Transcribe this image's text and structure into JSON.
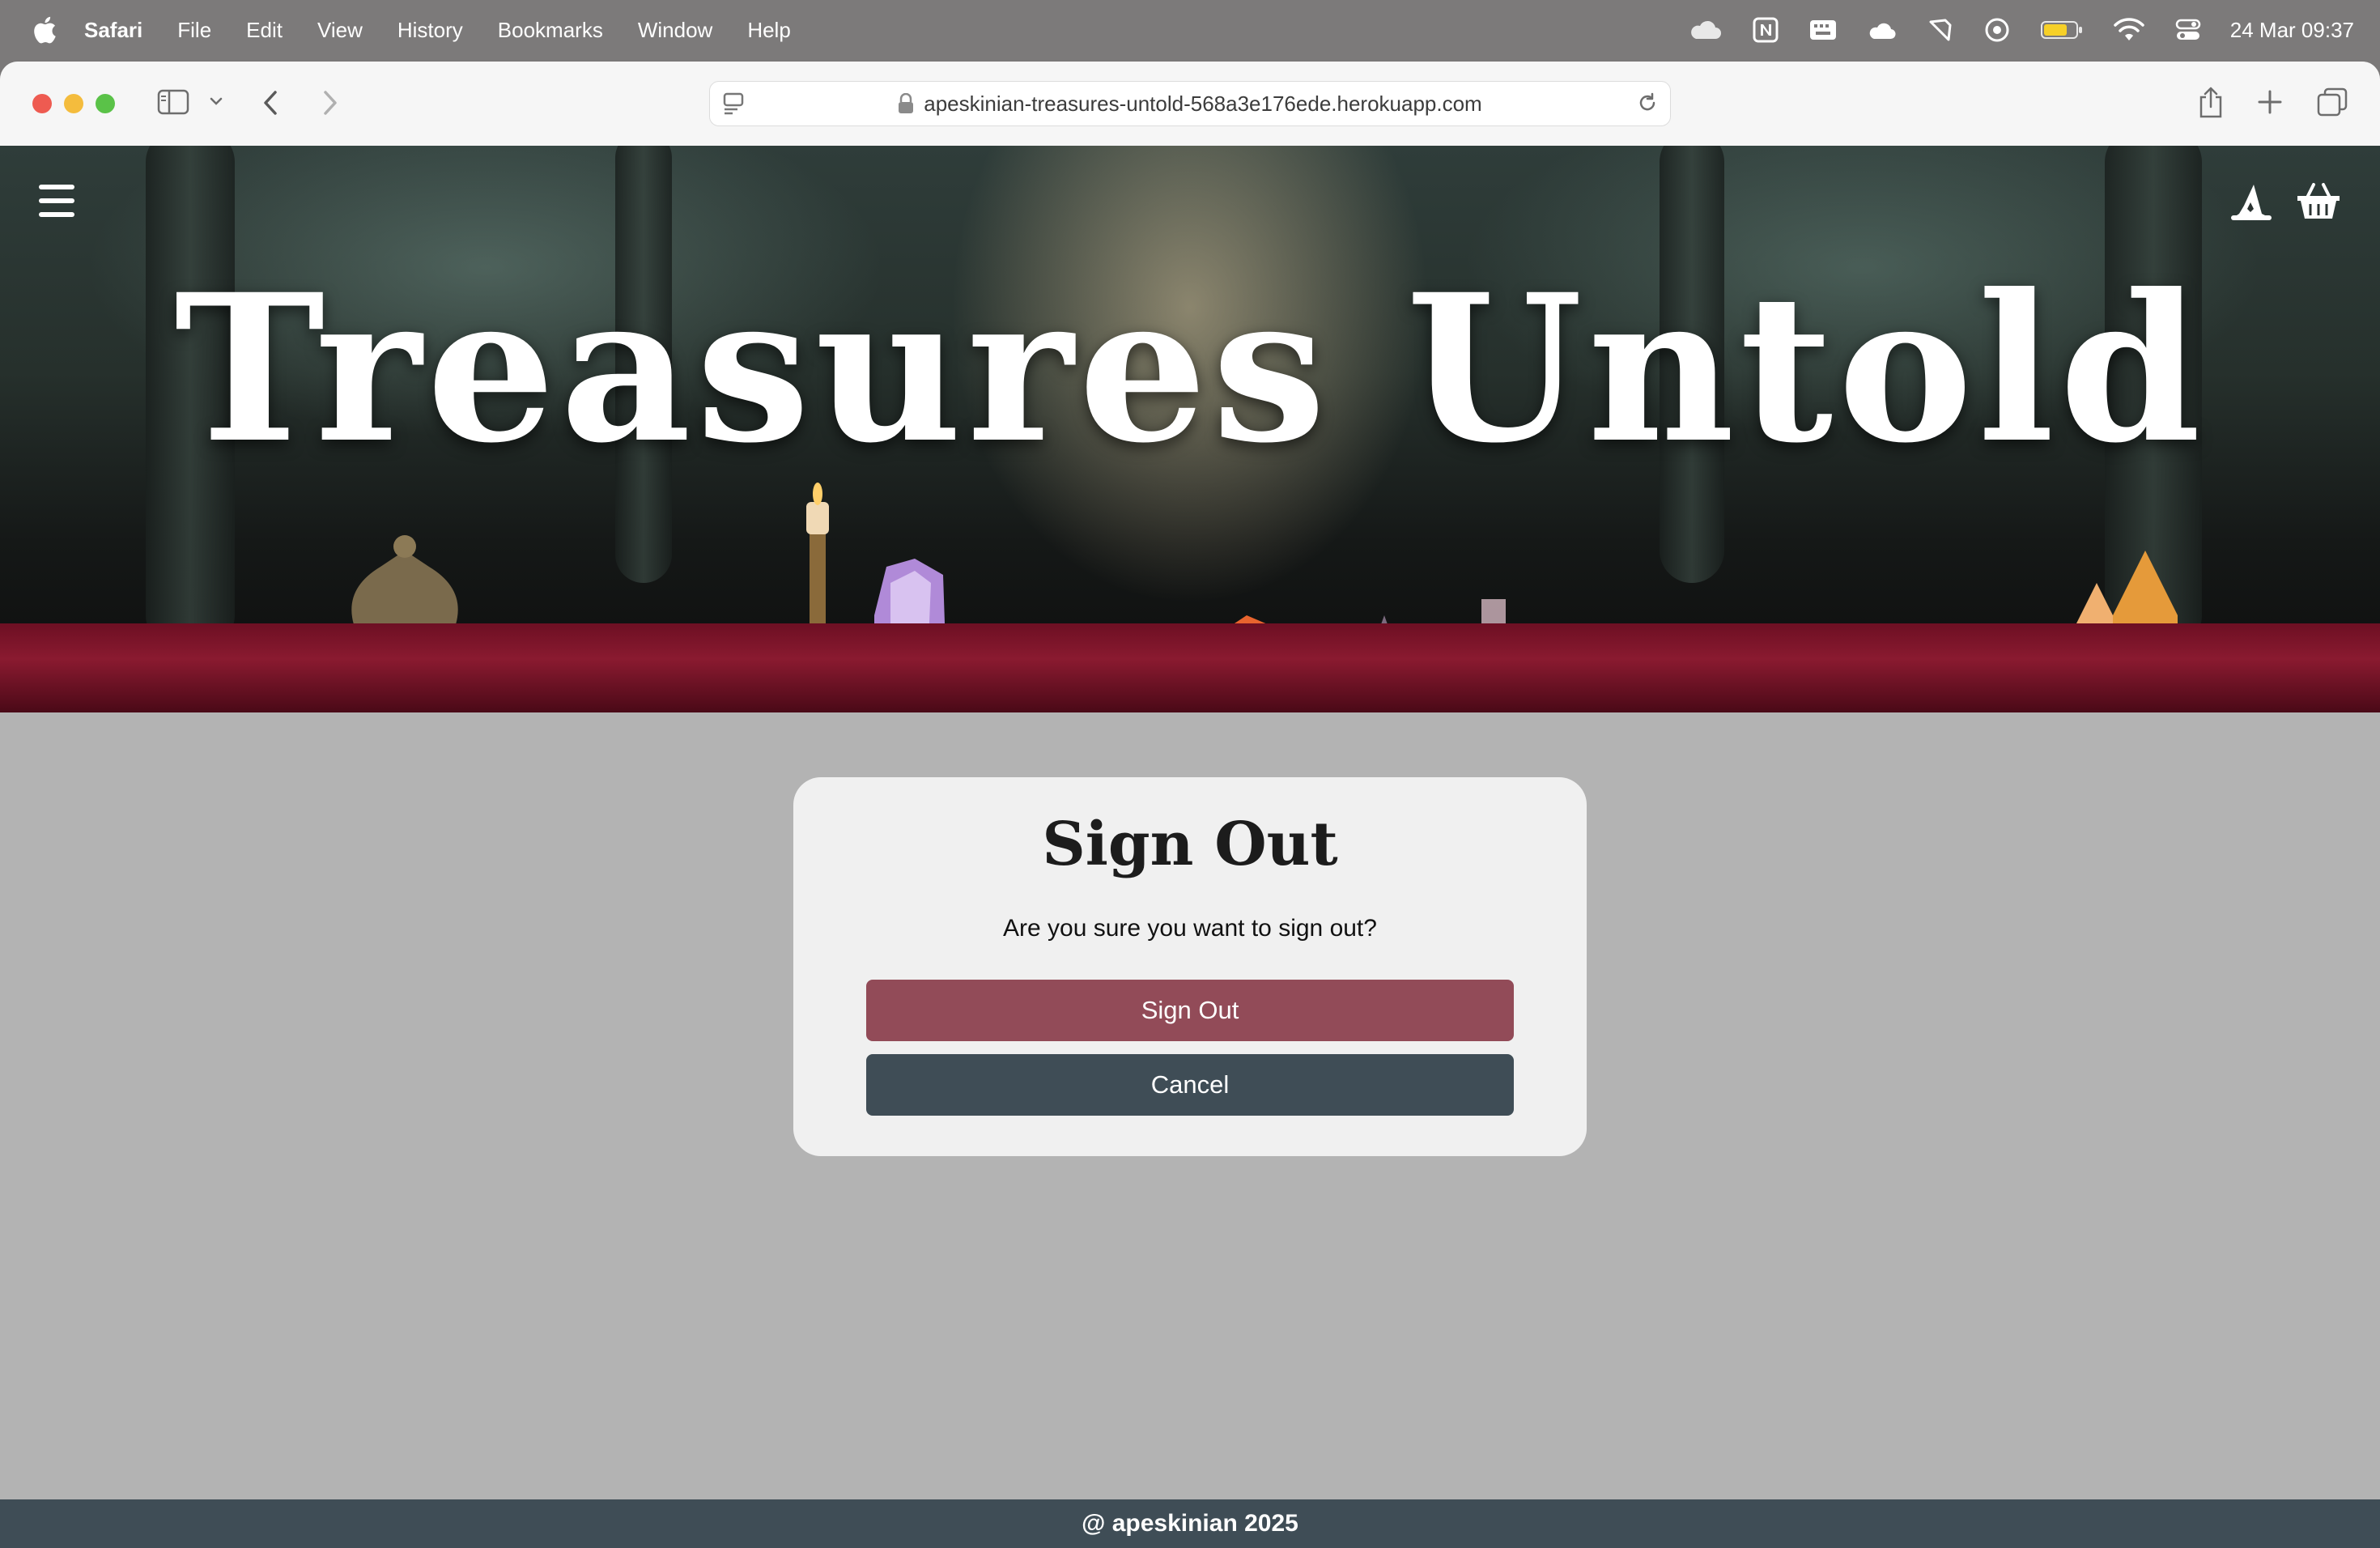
{
  "menubar": {
    "app_name": "Safari",
    "items": [
      "File",
      "Edit",
      "View",
      "History",
      "Bookmarks",
      "Window",
      "Help"
    ],
    "clock": "24 Mar  09:37",
    "status_icons": [
      "icloud-icon",
      "notion-icon",
      "keyboard-icon",
      "cloud-app-icon",
      "pen-icon",
      "target-icon",
      "battery-icon",
      "wifi-icon",
      "control-center-icon"
    ]
  },
  "browser": {
    "url": "apeskinian-treasures-untold-568a3e176ede.herokuapp.com"
  },
  "site": {
    "title": "Treasures Untold",
    "footer": "@ apeskinian 2025"
  },
  "dialog": {
    "title": "Sign Out",
    "message": "Are you sure you want to sign out?",
    "confirm_label": "Sign Out",
    "cancel_label": "Cancel"
  },
  "colors": {
    "confirm_button": "#924b58",
    "cancel_button": "#3f4d56",
    "footer_bg": "#3f4d56",
    "page_bg": "#b3b3b3",
    "card_bg": "#f0f0f0"
  }
}
